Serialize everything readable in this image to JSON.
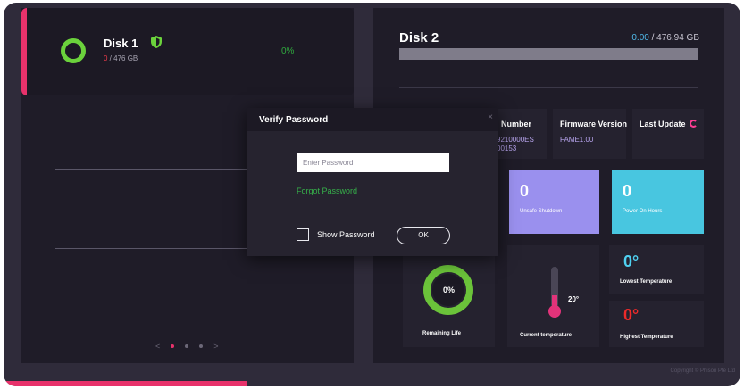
{
  "disk1": {
    "name": "Disk 1",
    "used": "0",
    "capacity": " / 476 GB",
    "percent": "0%",
    "ring_color": "#6bd23c",
    "accent": "#e8326b"
  },
  "pager": {
    "prev": "<",
    "next": ">"
  },
  "disk2": {
    "name": "Disk 2",
    "used": "0.00",
    "capacity": " / 476.94 GB",
    "bar_fill": 0
  },
  "info": {
    "serial_label": "l Number",
    "serial_value_1": "9210000ES",
    "serial_value_2": "00153",
    "firmware_label": "Firmware Version",
    "firmware_value": "FAME1.00",
    "last_update_label": "Last Update"
  },
  "stats": {
    "unsafe_shutdown_value": "0",
    "unsafe_shutdown_label": "Unsafe Shutdown",
    "power_on_hours_value": "0",
    "power_on_hours_label": "Power On Hours",
    "remaining_life_value": "0%",
    "remaining_life_label": "Remaining Life",
    "current_temp_value": "20°",
    "current_temp_label": "Current temperature",
    "lowest_temp_value": "0°",
    "lowest_temp_label": "Lowest Temperature",
    "highest_temp_value": "0°",
    "highest_temp_label": "Highest Temperature"
  },
  "colors": {
    "unsafe_tile": "#9a90ee",
    "power_tile": "#48c6e0",
    "lowest_temp": "#4fd0f0",
    "highest_temp": "#ee2a2a",
    "life_ring": "#6bc33a"
  },
  "modal": {
    "title": "Verify Password",
    "close": "×",
    "password_placeholder": "Enter Password",
    "forgot_link": "Forgot Password",
    "show_password_label": "Show Password",
    "ok_label": "OK"
  },
  "footer": {
    "copyright": "Copyright © Phison Pte Ltd"
  }
}
